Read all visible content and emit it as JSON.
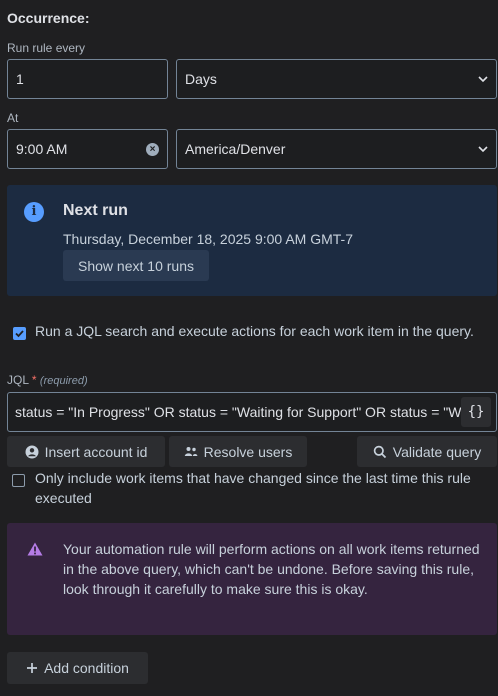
{
  "occurrence": {
    "title": "Occurrence:",
    "run_rule_label": "Run rule every",
    "interval_value": "1",
    "interval_unit": "Days",
    "at_label": "At",
    "time_value": "9:00 AM",
    "timezone": "America/Denver"
  },
  "next_run": {
    "heading": "Next run",
    "datetime": "Thursday, December 18, 2025 9:00 AM GMT-7",
    "show_next_button": "Show next 10 runs",
    "icon": "info-icon"
  },
  "jql_option": {
    "checked": true,
    "label": "Run a JQL search and execute actions for each work item in the query.",
    "jql_label": "JQL",
    "required_marker": "*",
    "required_text": "(required)",
    "jql_value": "status = \"In Progress\" OR status = \"Waiting for Support\" OR status = \"Waiting for Customer\"",
    "brace_button": "{}"
  },
  "actions": {
    "insert_account_id": "Insert account id",
    "resolve_users": "Resolve users",
    "validate_query": "Validate query"
  },
  "changed_option": {
    "checked": false,
    "label": "Only include work items that have changed since the last time this rule executed"
  },
  "warning": {
    "icon": "warning-icon",
    "text": "Your automation rule will perform actions on all work items returned in the above query, which can't be undone. Before saving this rule, look through it carefully to make sure this is okay."
  },
  "footer": {
    "add_condition": "Add condition"
  },
  "colors": {
    "background": "#1f1f21",
    "info_panel": "#1c2b41",
    "warning_panel": "#35243f",
    "accent_blue": "#579dff",
    "warning_purple": "#b57ce6",
    "required_red": "#f87168"
  }
}
